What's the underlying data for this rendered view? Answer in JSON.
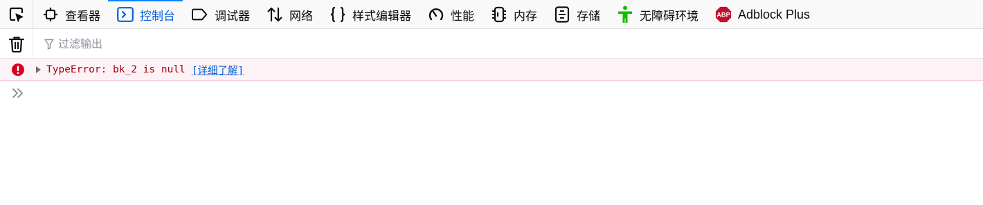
{
  "toolbar": {
    "tabs": [
      {
        "label": "查看器",
        "icon": "inspector-icon"
      },
      {
        "label": "控制台",
        "icon": "console-icon",
        "selected": true
      },
      {
        "label": "调试器",
        "icon": "debugger-icon"
      },
      {
        "label": "网络",
        "icon": "network-icon"
      },
      {
        "label": "样式编辑器",
        "icon": "style-editor-icon"
      },
      {
        "label": "性能",
        "icon": "performance-icon"
      },
      {
        "label": "内存",
        "icon": "memory-icon"
      },
      {
        "label": "存储",
        "icon": "storage-icon"
      },
      {
        "label": "无障碍环境",
        "icon": "accessibility-icon"
      },
      {
        "label": "Adblock Plus",
        "icon": "abp-icon"
      }
    ],
    "abp_badge": "ABP"
  },
  "filterbar": {
    "placeholder": "过滤输出"
  },
  "console": {
    "messages": [
      {
        "level": "error",
        "text": "TypeError: bk_2 is null",
        "learn_more": "[详细了解]"
      }
    ]
  },
  "colors": {
    "accent": "#0a84ff",
    "selected_text": "#0060df",
    "error_text": "#a4000f",
    "error_bg": "#fdf2f5",
    "error_icon": "#d70022",
    "accessibility_green": "#12bc00",
    "abp_red": "#c70d2c"
  }
}
